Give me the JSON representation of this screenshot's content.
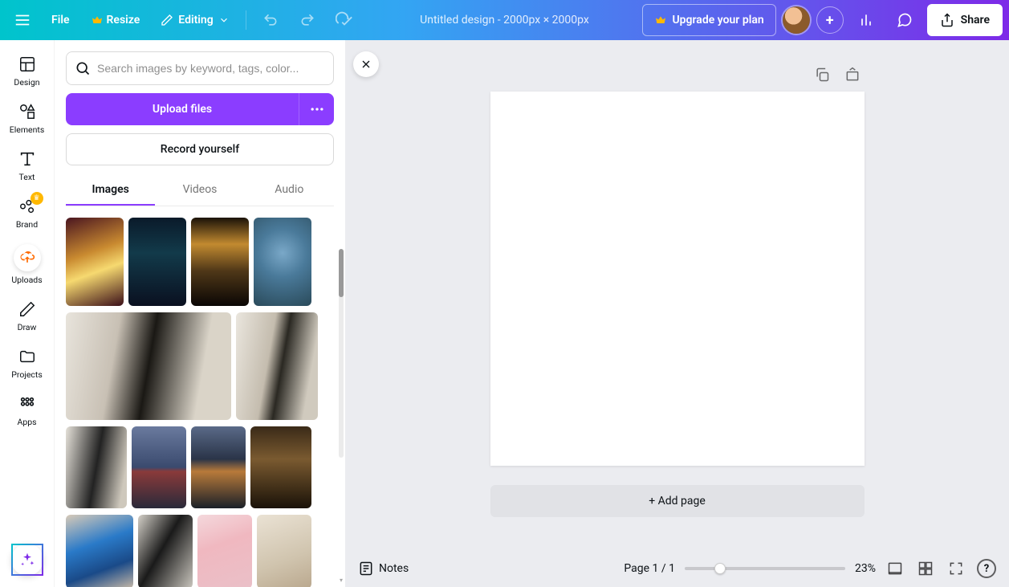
{
  "topbar": {
    "file": "File",
    "resize": "Resize",
    "editing": "Editing",
    "doc_title": "Untitled design - 2000px × 2000px",
    "upgrade": "Upgrade your plan",
    "share": "Share"
  },
  "nav": {
    "design": "Design",
    "elements": "Elements",
    "text": "Text",
    "brand": "Brand",
    "uploads": "Uploads",
    "draw": "Draw",
    "projects": "Projects",
    "apps": "Apps"
  },
  "panel": {
    "search_placeholder": "Search images by keyword, tags, color...",
    "upload_files": "Upload files",
    "record_yourself": "Record yourself",
    "tabs": {
      "images": "Images",
      "videos": "Videos",
      "audio": "Audio"
    }
  },
  "canvas": {
    "add_page": "+ Add page"
  },
  "bottombar": {
    "notes": "Notes",
    "page_info": "Page 1 / 1",
    "zoom": "23%",
    "help": "?"
  },
  "colors": {
    "purple": "#8b3dff"
  }
}
